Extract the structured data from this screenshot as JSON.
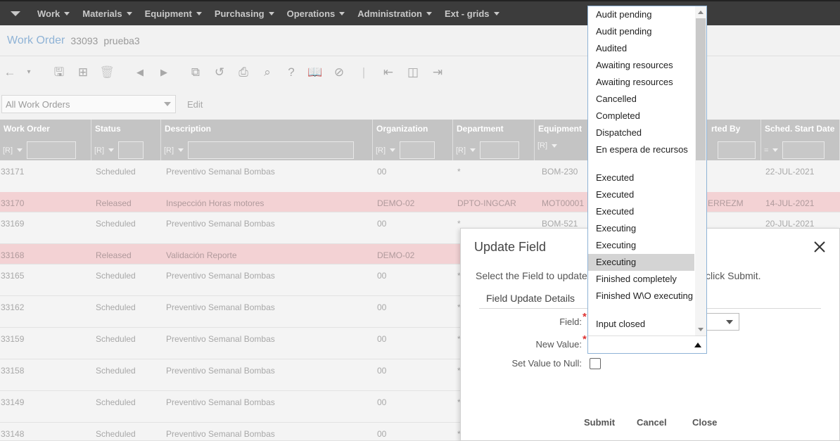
{
  "nav": {
    "items": [
      "Work",
      "Materials",
      "Equipment",
      "Purchasing",
      "Operations",
      "Administration",
      "Ext - grids"
    ]
  },
  "page": {
    "title": "Work Order",
    "record_id": "33093",
    "record_desc": "prueba3"
  },
  "filter": {
    "dataspy": "All Work Orders",
    "edit_label": "Edit"
  },
  "grid": {
    "columns": [
      "Work Order",
      "Status",
      "Description",
      "Organization",
      "Department",
      "Equipment",
      "rted By",
      "Sched. Start Date"
    ],
    "filter_ops": [
      "[R]",
      "[R]",
      "[R]",
      "[R]",
      "[R]",
      "[R]",
      "=",
      "="
    ],
    "rows": [
      {
        "wo": "33171",
        "status": "Scheduled",
        "desc": "Preventivo Semanal Bombas",
        "org": "00",
        "dept": "*",
        "equip": "BOM-230",
        "by": "",
        "date": "22-JUL-2021",
        "red": false
      },
      {
        "wo": "33170",
        "status": "Released",
        "desc": "Inspección Horas motores",
        "org": "DEMO-02",
        "dept": "DPTO-INGCAR",
        "equip": "MOT00001",
        "by": "ERREZM",
        "date": "14-JUL-2021",
        "red": true
      },
      {
        "wo": "33169",
        "status": "Scheduled",
        "desc": "Preventivo Semanal Bombas",
        "org": "00",
        "dept": "*",
        "equip": "BOM-521",
        "by": "",
        "date": "20-JUL-2021",
        "red": false
      },
      {
        "wo": "33168",
        "status": "Released",
        "desc": "Validación Reporte",
        "org": "DEMO-02",
        "dept": "",
        "equip": "",
        "by": "",
        "date": "",
        "red": true
      },
      {
        "wo": "33165",
        "status": "Scheduled",
        "desc": "Preventivo Semanal Bombas",
        "org": "00",
        "dept": "*",
        "equip": "",
        "by": "",
        "date": "",
        "red": false
      },
      {
        "wo": "33162",
        "status": "Scheduled",
        "desc": "Preventivo Semanal Bombas",
        "org": "00",
        "dept": "*",
        "equip": "",
        "by": "",
        "date": "",
        "red": false
      },
      {
        "wo": "33159",
        "status": "Scheduled",
        "desc": "Preventivo Semanal Bombas",
        "org": "00",
        "dept": "*",
        "equip": "",
        "by": "",
        "date": "",
        "red": false
      },
      {
        "wo": "33158",
        "status": "Scheduled",
        "desc": "Preventivo Semanal Bombas",
        "org": "00",
        "dept": "*",
        "equip": "",
        "by": "",
        "date": "",
        "red": false
      },
      {
        "wo": "33149",
        "status": "Scheduled",
        "desc": "Preventivo Semanal Bombas",
        "org": "00",
        "dept": "*",
        "equip": "",
        "by": "",
        "date": "",
        "red": false
      },
      {
        "wo": "33148",
        "status": "Scheduled",
        "desc": "Preventivo Semanal Bombas",
        "org": "00",
        "dept": "*",
        "equip": "",
        "by": "",
        "date": "",
        "red": false
      }
    ]
  },
  "modal": {
    "title": "Update Field",
    "desc_left": "Select the Field to update",
    "desc_right": "click Submit.",
    "tab_label": "Field Update Details",
    "field_label": "Field:",
    "new_value_label": "New Value:",
    "null_label": "Set Value to Null:",
    "submit": "Submit",
    "cancel": "Cancel",
    "close": "Close"
  },
  "dropdown": {
    "items": [
      "Audit pending",
      "Audit pending",
      "Audited",
      "Awaiting resources",
      "Awaiting resources",
      "Cancelled",
      "Completed",
      "Dispatched",
      "En espera de recursos",
      "Executed",
      "Executed",
      "Executed",
      "Executing",
      "Executing",
      "Executing",
      "Finished completely",
      "Finished W\\O executing",
      "Input closed"
    ],
    "highlighted_index": 14
  }
}
